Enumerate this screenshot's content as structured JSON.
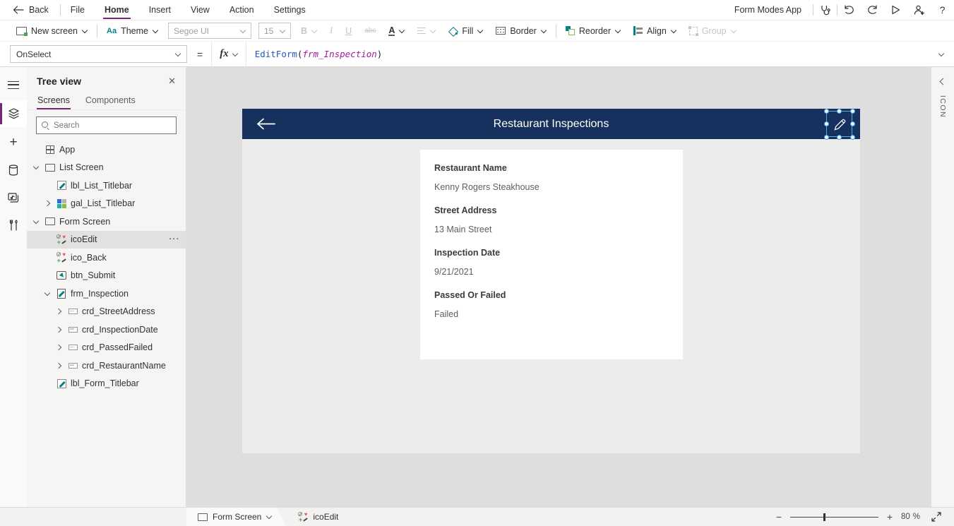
{
  "colors": {
    "accent_purple": "#742774",
    "titlebar_navy": "#17315f",
    "icon_teal": "#038387",
    "formula_function_color": "#2458c4",
    "formula_identifier_color": "#a3199c"
  },
  "menu_bar": {
    "back_label": "Back",
    "items": [
      "File",
      "Home",
      "Insert",
      "View",
      "Action",
      "Settings"
    ],
    "active_item": "Home",
    "app_name": "Form Modes App"
  },
  "toolbar": {
    "new_screen_label": "New screen",
    "theme_label": "Theme",
    "theme_icon_text": "Aa",
    "font_name": "Segoe UI",
    "font_size": "15",
    "bold_label": "B",
    "italic_label": "I",
    "underline_label": "U",
    "strikethrough_label": "abc",
    "font_color_label": "A",
    "fill_label": "Fill",
    "border_label": "Border",
    "reorder_label": "Reorder",
    "align_label": "Align",
    "group_label": "Group"
  },
  "formula_bar": {
    "property": "OnSelect",
    "equals": "=",
    "fx_label": "fx",
    "function_name": "EditForm",
    "paren_open": "(",
    "argument": "frm_Inspection",
    "paren_close": ")"
  },
  "tree_panel": {
    "title": "Tree view",
    "tabs": [
      "Screens",
      "Components"
    ],
    "active_tab": "Screens",
    "search_placeholder": "Search",
    "items": [
      {
        "label": "App",
        "icon": "app",
        "level": 0,
        "chevron": null,
        "selected": false,
        "ellipsis": false
      },
      {
        "label": "List Screen",
        "icon": "screen",
        "level": 0,
        "chevron": "down",
        "selected": false,
        "ellipsis": false
      },
      {
        "label": "lbl_List_Titlebar",
        "icon": "label",
        "level": 1,
        "chevron": null,
        "selected": false,
        "ellipsis": false
      },
      {
        "label": "gal_List_Titlebar",
        "icon": "gallery",
        "level": 1,
        "chevron": "right",
        "selected": false,
        "ellipsis": false
      },
      {
        "label": "Form Screen",
        "icon": "screen",
        "level": 0,
        "chevron": "down",
        "selected": false,
        "ellipsis": false
      },
      {
        "label": "icoEdit",
        "icon": "iconctl",
        "level": 1,
        "chevron": null,
        "selected": true,
        "ellipsis": true
      },
      {
        "label": "ico_Back",
        "icon": "iconctl",
        "level": 1,
        "chevron": null,
        "selected": false,
        "ellipsis": false
      },
      {
        "label": "btn_Submit",
        "icon": "button",
        "level": 1,
        "chevron": null,
        "selected": false,
        "ellipsis": false
      },
      {
        "label": "frm_Inspection",
        "icon": "form",
        "level": 1,
        "chevron": "down",
        "selected": false,
        "ellipsis": false
      },
      {
        "label": "crd_StreetAddress",
        "icon": "card",
        "level": 2,
        "chevron": "right",
        "selected": false,
        "ellipsis": false
      },
      {
        "label": "crd_InspectionDate",
        "icon": "card",
        "level": 2,
        "chevron": "right",
        "selected": false,
        "ellipsis": false
      },
      {
        "label": "crd_PassedFailed",
        "icon": "card",
        "level": 2,
        "chevron": "right",
        "selected": false,
        "ellipsis": false
      },
      {
        "label": "crd_RestaurantName",
        "icon": "card",
        "level": 2,
        "chevron": "right",
        "selected": false,
        "ellipsis": false
      },
      {
        "label": "lbl_Form_Titlebar",
        "icon": "label",
        "level": 1,
        "chevron": null,
        "selected": false,
        "ellipsis": false
      }
    ]
  },
  "canvas": {
    "titlebar_title": "Restaurant Inspections",
    "form_fields": [
      {
        "label": "Restaurant Name",
        "value": "Kenny Rogers Steakhouse"
      },
      {
        "label": "Street Address",
        "value": "13 Main Street"
      },
      {
        "label": "Inspection Date",
        "value": "9/21/2021"
      },
      {
        "label": "Passed Or Failed",
        "value": "Failed"
      }
    ]
  },
  "right_panel": {
    "label": "ICON"
  },
  "status_bar": {
    "screen_name": "Form Screen",
    "control_name": "icoEdit",
    "zoom_value": "80",
    "zoom_unit": "%"
  }
}
